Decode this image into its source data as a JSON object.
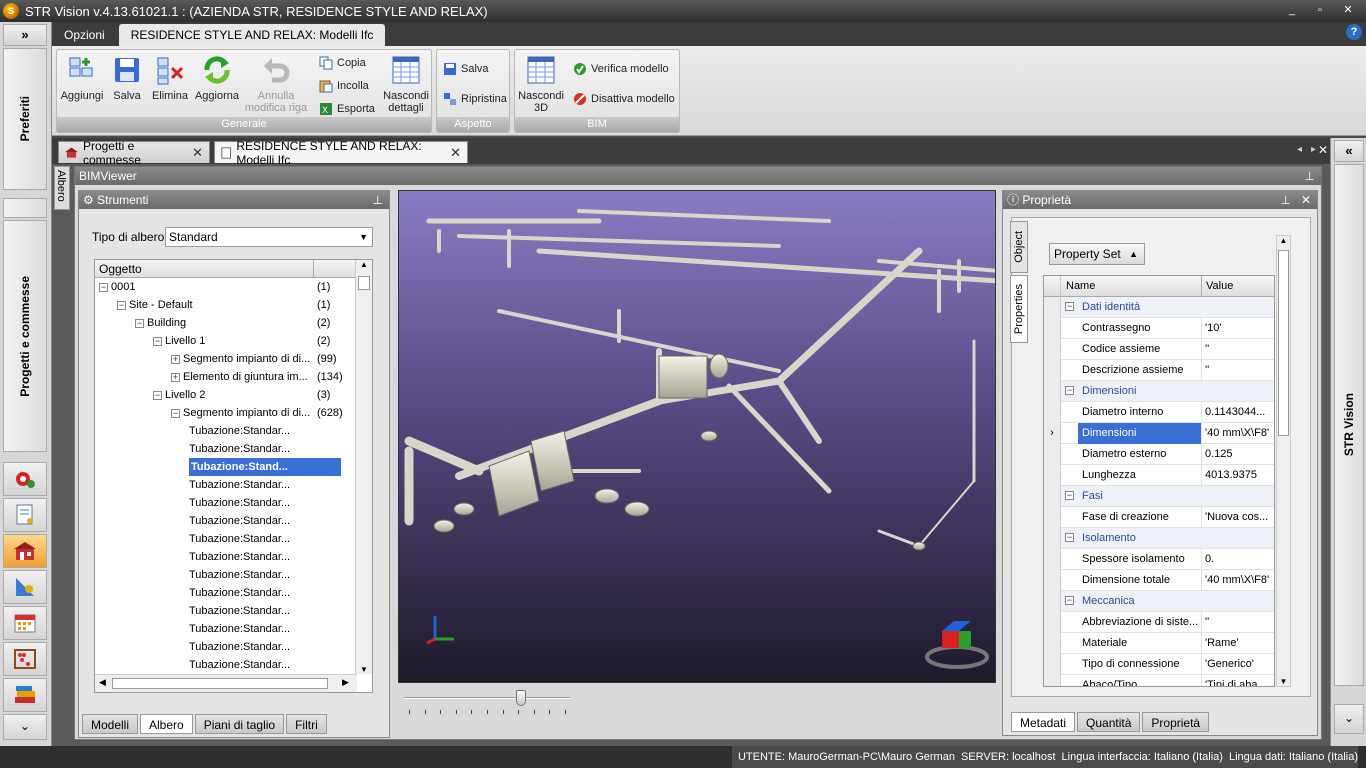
{
  "window": {
    "title": "STR Vision v.4.13.61021.1 : (AZIENDA STR, RESIDENCE STYLE AND RELAX)",
    "minimize": "_",
    "restore": "▫",
    "close": "✕"
  },
  "ribbon_tabs": [
    "Opzioni",
    "RESIDENCE STYLE AND RELAX: Modelli Ifc"
  ],
  "ribbon": {
    "groups": {
      "generale": "Generale",
      "aspetto": "Aspetto",
      "bim": "BIM"
    },
    "buttons": {
      "aggiungi": "Aggiungi",
      "salva": "Salva",
      "elimina": "Elimina",
      "aggiorna": "Aggiorna",
      "annulla_1": "Annulla",
      "annulla_2": "modifica riga",
      "copia": "Copia",
      "incolla": "Incolla",
      "esporta": "Esporta",
      "nascondi_dettagli_1": "Nascondi",
      "nascondi_dettagli_2": "dettagli",
      "salva_aspetto": "Salva",
      "ripristina": "Ripristina",
      "nascondi_3d_1": "Nascondi",
      "nascondi_3d_2": "3D",
      "verifica_modello": "Verifica modello",
      "disattiva_modello": "Disattiva modello"
    }
  },
  "left_sidebar": {
    "toggle": "»",
    "preferiti": "Preferiti",
    "progetti": "Progetti e commesse",
    "more": "⌄"
  },
  "right_sidebar": {
    "toggle": "«",
    "label": "STR Vision",
    "more": "⌄"
  },
  "doc_tabs": [
    "Progetti e commesse",
    "RESIDENCE STYLE AND RELAX: Modelli Ifc"
  ],
  "albero_side_tab": "Albero",
  "bimviewer": {
    "title": "BIMViewer"
  },
  "strumenti": {
    "title": "Strumenti",
    "tipo_label": "Tipo di albero:",
    "tipo_value": "Standard",
    "column": "Oggetto",
    "rows": [
      {
        "label": "0001",
        "count": "(1)",
        "level": 0,
        "exp": "−"
      },
      {
        "label": "Site - Default",
        "count": "(1)",
        "level": 1,
        "exp": "−"
      },
      {
        "label": "Building",
        "count": "(2)",
        "level": 2,
        "exp": "−"
      },
      {
        "label": "Livello 1",
        "count": "(2)",
        "level": 3,
        "exp": "−"
      },
      {
        "label": "Segmento impianto di di...",
        "count": "(99)",
        "level": 4,
        "exp": "+"
      },
      {
        "label": "Elemento di giuntura im...",
        "count": "(134)",
        "level": 4,
        "exp": "+"
      },
      {
        "label": "Livello 2",
        "count": "(3)",
        "level": 3,
        "exp": "−"
      },
      {
        "label": "Segmento impianto di di...",
        "count": "(628)",
        "level": 4,
        "exp": "−"
      },
      {
        "label": "Tubazione:Standar...",
        "count": "",
        "level": 5,
        "exp": ""
      },
      {
        "label": "Tubazione:Standar...",
        "count": "",
        "level": 5,
        "exp": ""
      },
      {
        "label": "Tubazione:Stand...",
        "count": "",
        "level": 5,
        "exp": "",
        "selected": true
      },
      {
        "label": "Tubazione:Standar...",
        "count": "",
        "level": 5,
        "exp": ""
      },
      {
        "label": "Tubazione:Standar...",
        "count": "",
        "level": 5,
        "exp": ""
      },
      {
        "label": "Tubazione:Standar...",
        "count": "",
        "level": 5,
        "exp": ""
      },
      {
        "label": "Tubazione:Standar...",
        "count": "",
        "level": 5,
        "exp": ""
      },
      {
        "label": "Tubazione:Standar...",
        "count": "",
        "level": 5,
        "exp": ""
      },
      {
        "label": "Tubazione:Standar...",
        "count": "",
        "level": 5,
        "exp": ""
      },
      {
        "label": "Tubazione:Standar...",
        "count": "",
        "level": 5,
        "exp": ""
      },
      {
        "label": "Tubazione:Standar...",
        "count": "",
        "level": 5,
        "exp": ""
      },
      {
        "label": "Tubazione:Standar...",
        "count": "",
        "level": 5,
        "exp": ""
      },
      {
        "label": "Tubazione:Standar...",
        "count": "",
        "level": 5,
        "exp": ""
      },
      {
        "label": "Tubazione:Standar...",
        "count": "",
        "level": 5,
        "exp": ""
      }
    ],
    "bottom_tabs": [
      "Modelli",
      "Albero",
      "Piani di taglio",
      "Filtri"
    ]
  },
  "viewport": {
    "slider_fraction": 0.72
  },
  "proprieta": {
    "title": "Proprietà",
    "side_tabs": [
      "Object",
      "Properties"
    ],
    "property_set_button": "Property Set",
    "col_name": "Name",
    "col_value": "Value",
    "rows": [
      {
        "cat": true,
        "name": "Dati identità"
      },
      {
        "name": "Contrassegno",
        "value": "'10'"
      },
      {
        "name": "Codice assieme",
        "value": "''"
      },
      {
        "name": "Descrizione assieme",
        "value": "''"
      },
      {
        "cat": true,
        "name": "Dimensioni"
      },
      {
        "name": "Diametro interno",
        "value": "0.1143044..."
      },
      {
        "name": "Dimensioni",
        "value": "'40 mm\\X\\F8'",
        "selected": true
      },
      {
        "name": "Diametro esterno",
        "value": "0.125"
      },
      {
        "name": "Lunghezza",
        "value": "4013.9375"
      },
      {
        "cat": true,
        "name": "Fasi"
      },
      {
        "name": "Fase di creazione",
        "value": "'Nuova cos..."
      },
      {
        "cat": true,
        "name": "Isolamento"
      },
      {
        "name": "Spessore isolamento",
        "value": "0."
      },
      {
        "name": "Dimensione totale",
        "value": "'40 mm\\X\\F8'"
      },
      {
        "cat": true,
        "name": "Meccanica"
      },
      {
        "name": "Abbreviazione di siste...",
        "value": "''"
      },
      {
        "name": "Materiale",
        "value": "'Rame'"
      },
      {
        "name": "Tipo di connessione",
        "value": "'Generico'"
      },
      {
        "name": "Abaco/Tipo",
        "value": "'Tipi di aba..."
      }
    ],
    "bottom_tabs": [
      "Metadati",
      "Quantità",
      "Proprietà"
    ]
  },
  "status": {
    "utente": "UTENTE: MauroGerman-PC\\Mauro German",
    "server": "SERVER: localhost",
    "lingua_interfaccia": "Lingua interfaccia: Italiano (Italia)",
    "lingua_dati": "Lingua dati: Italiano (Italia)"
  }
}
